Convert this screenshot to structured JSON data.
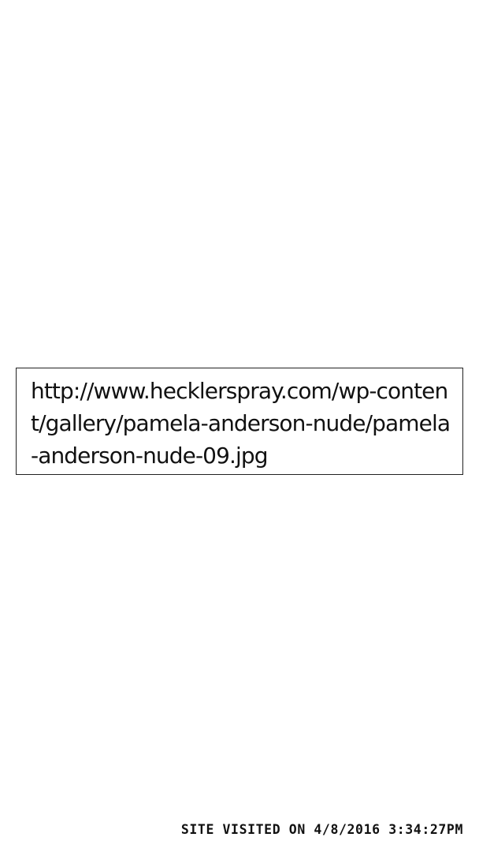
{
  "link": {
    "url": "http://www.hecklerspray.com/wp-content/gallery/pamela-anderson-nude/pamela-anderson-nude-09.jpg"
  },
  "footer": {
    "visit_stamp": "SITE VISITED ON 4/8/2016 3:34:27PM"
  }
}
